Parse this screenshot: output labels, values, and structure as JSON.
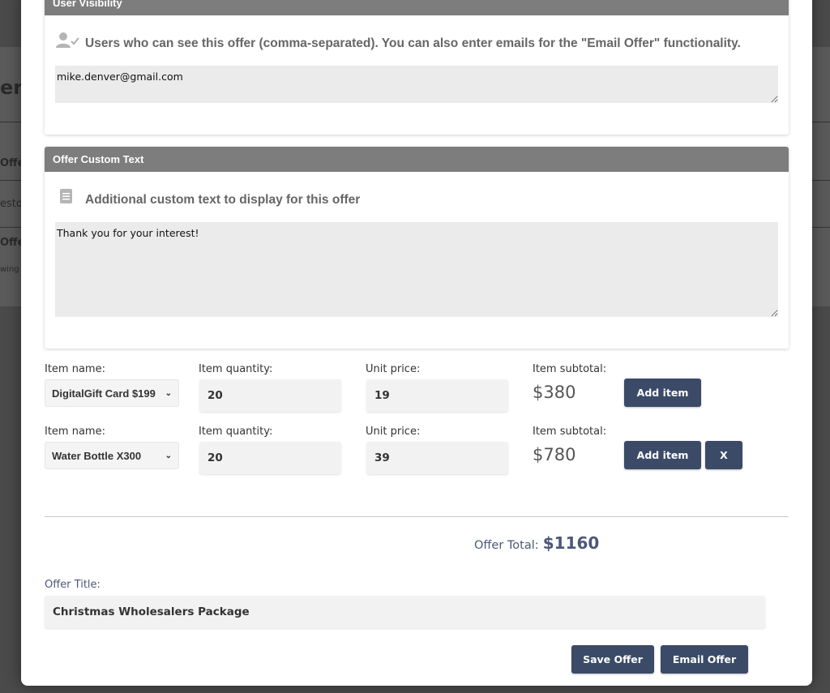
{
  "background": {
    "fragments": [
      "ers",
      "Offe",
      "esto",
      "Offe",
      "wing"
    ]
  },
  "user_visibility": {
    "header": "User Visibility",
    "description": "Users who can see this offer (comma-separated). You can also enter emails for the \"Email Offer\" functionality.",
    "value": "mike.denver@gmail.com",
    "icon": "user-check-icon"
  },
  "custom_text": {
    "header": "Offer Custom Text",
    "description": "Additional custom text to display for this offer",
    "value": "Thank you for your interest!",
    "icon": "document-icon"
  },
  "item_labels": {
    "name": "Item name:",
    "quantity": "Item quantity:",
    "unit_price": "Unit price:",
    "subtotal": "Item subtotal:"
  },
  "items": [
    {
      "name": "DigitalGift Card $199",
      "quantity": "20",
      "unit_price": "19",
      "subtotal": "$380",
      "add_label": "Add item"
    },
    {
      "name": "Water Bottle X300",
      "quantity": "20",
      "unit_price": "39",
      "subtotal": "$780",
      "add_label": "Add item",
      "remove_label": "X"
    }
  ],
  "total": {
    "label": "Offer Total:",
    "value": "$1160"
  },
  "offer_title": {
    "label": "Offer Title:",
    "value": "Christmas Wholesalers Package"
  },
  "actions": {
    "save_label": "Save Offer",
    "email_label": "Email Offer"
  },
  "colors": {
    "header_bg": "#7d7d7d",
    "button_bg": "#3b4a67",
    "accent_text": "#4b5877"
  }
}
